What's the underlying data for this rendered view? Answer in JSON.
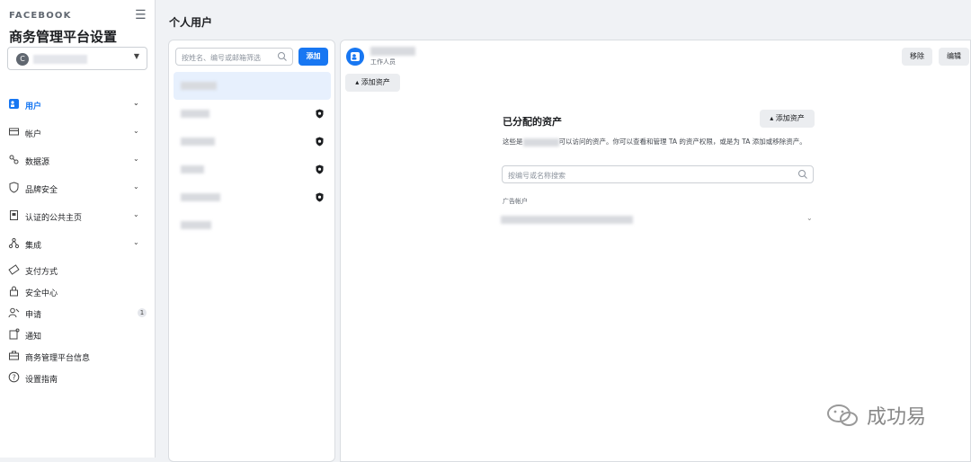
{
  "sidebar": {
    "brand": "FACEBOOK",
    "title": "商务管理平台设置",
    "account_initial": "C",
    "items": [
      {
        "label": "用户",
        "icon": "users-icon",
        "expandable": true,
        "active": true
      },
      {
        "label": "帐户",
        "icon": "account-icon",
        "expandable": true
      },
      {
        "label": "数据源",
        "icon": "data-source-icon",
        "expandable": true
      },
      {
        "label": "品牌安全",
        "icon": "shield-icon",
        "expandable": true
      },
      {
        "label": "认证的公共主页",
        "icon": "verified-page-icon",
        "expandable": true
      },
      {
        "label": "集成",
        "icon": "integration-icon",
        "expandable": true
      },
      {
        "label": "支付方式",
        "icon": "payment-icon"
      },
      {
        "label": "安全中心",
        "icon": "lock-icon"
      },
      {
        "label": "申请",
        "icon": "request-icon",
        "badge": "1"
      },
      {
        "label": "通知",
        "icon": "notification-icon"
      },
      {
        "label": "商务管理平台信息",
        "icon": "briefcase-icon"
      },
      {
        "label": "设置指南",
        "icon": "help-icon"
      }
    ]
  },
  "header": {
    "title": "个人用户"
  },
  "people_list": {
    "search_placeholder": "按姓名、编号或邮箱筛选",
    "add_label": "添加"
  },
  "detail": {
    "role": "工作人员",
    "remove_label": "移除",
    "edit_label": "编辑",
    "add_asset_label": "添加资产",
    "section_title": "已分配的资产",
    "section_add_label": "添加资产",
    "desc_prefix": "这些是",
    "desc_suffix": "可以访问的资产。你可以查看和管理 TA 的资产权限，或是为 TA 添加或移除资产。",
    "asset_search_placeholder": "按编号或名称搜索",
    "asset_type_label": "广告帐户"
  },
  "watermark": {
    "text": "成功易"
  }
}
